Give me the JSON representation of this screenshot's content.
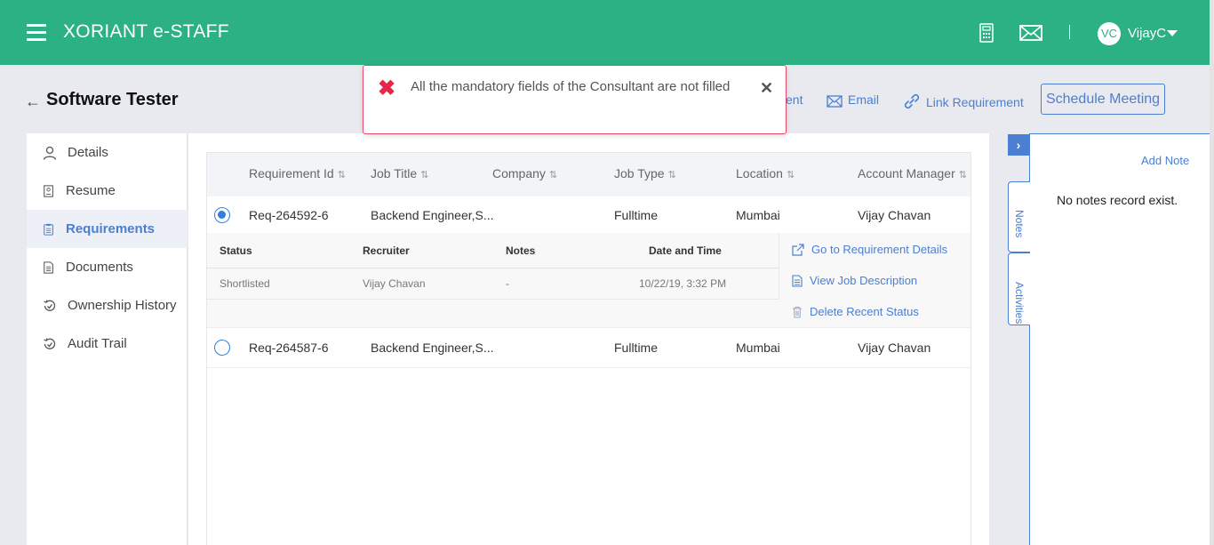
{
  "header": {
    "app_title": "XORIANT e-STAFF",
    "user_initials": "VC",
    "username": "VijayC",
    "brand_color": "#2bb184"
  },
  "page": {
    "title": "Software Tester",
    "actions": {
      "partial_label": "ent",
      "email_label": "Email",
      "link_requirement_label": "Link Requirement",
      "schedule_meeting_label": "Schedule Meeting"
    }
  },
  "sidebar": {
    "items": [
      {
        "label": "Details",
        "icon": "person-icon"
      },
      {
        "label": "Resume",
        "icon": "resume-icon"
      },
      {
        "label": "Requirements",
        "icon": "clipboard-icon"
      },
      {
        "label": "Documents",
        "icon": "document-icon"
      },
      {
        "label": "Ownership History",
        "icon": "history-icon"
      },
      {
        "label": "Audit Trail",
        "icon": "history-icon"
      }
    ]
  },
  "table": {
    "columns": [
      "Requirement Id",
      "Job Title",
      "Company",
      "Job Type",
      "Location",
      "Account Manager"
    ],
    "rows": [
      {
        "selected": true,
        "req_id": "Req-264592-6",
        "job_title": "Backend Engineer,S...",
        "company": "",
        "job_type": "Fulltime",
        "location": "Mumbai",
        "account_manager": "Vijay Chavan"
      },
      {
        "selected": false,
        "req_id": "Req-264587-6",
        "job_title": "Backend Engineer,S...",
        "company": "",
        "job_type": "Fulltime",
        "location": "Mumbai",
        "account_manager": "Vijay Chavan"
      }
    ],
    "detail": {
      "headers": [
        "Status",
        "Recruiter",
        "Notes",
        "Date and Time"
      ],
      "values": [
        "Shortlisted",
        "Vijay Chavan",
        "-",
        "10/22/19, 3:32 PM"
      ],
      "actions": [
        "Go to Requirement Details",
        "View Job Description",
        "Delete Recent Status"
      ]
    }
  },
  "notes_panel": {
    "tabs": [
      "Notes",
      "Activities"
    ],
    "add_note_label": "Add Note",
    "empty_text": "No notes record exist."
  },
  "toast": {
    "message": "All the mandatory fields of the Consultant are not filled",
    "error_color": "#e5284a"
  }
}
